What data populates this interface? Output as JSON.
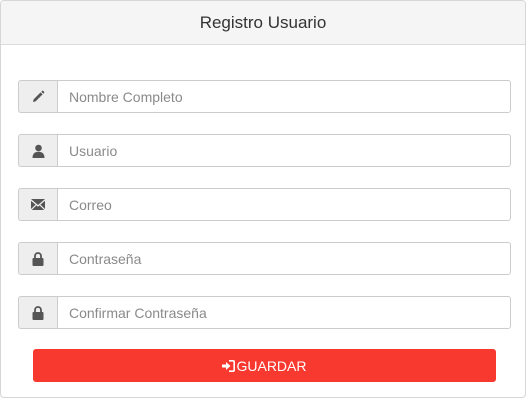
{
  "header": {
    "title": "Registro Usuario"
  },
  "form": {
    "fields": [
      {
        "icon": "pencil-icon",
        "placeholder": "Nombre Completo",
        "value": ""
      },
      {
        "icon": "user-icon",
        "placeholder": "Usuario",
        "value": ""
      },
      {
        "icon": "envelope-icon",
        "placeholder": "Correo",
        "value": ""
      },
      {
        "icon": "lock-icon",
        "placeholder": "Contraseña",
        "value": ""
      },
      {
        "icon": "lock-icon",
        "placeholder": "Confirmar Contraseña",
        "value": ""
      }
    ],
    "submit": {
      "label": "GUARDAR",
      "icon": "sign-in-icon",
      "color": "#f8392f"
    }
  }
}
